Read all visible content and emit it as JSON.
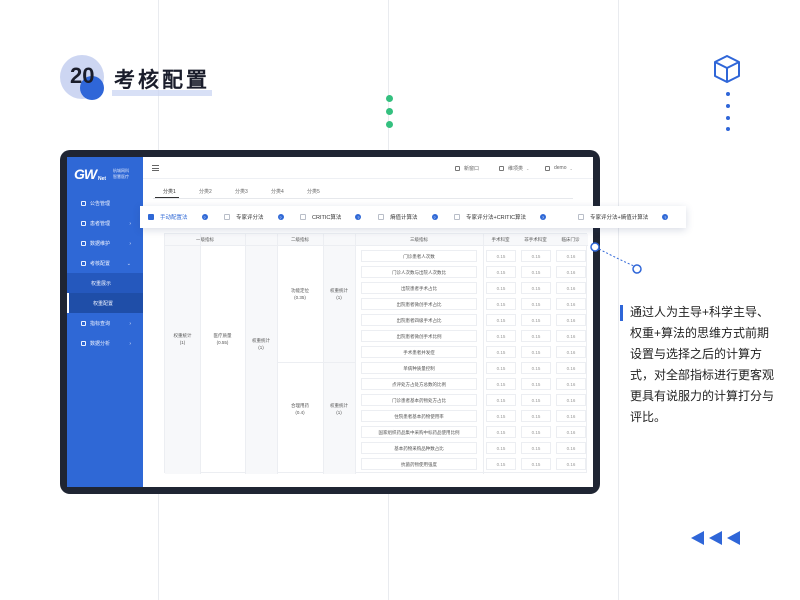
{
  "slide": {
    "number": "20",
    "title": "考核配置",
    "description": "通过人为主导+科学主导、权重+算法的思维方式前期设置与选择之后的计算方式，对全部指标进行更客观更具有说服力的计算打分与评比。",
    "accent_color": "#2f66d8",
    "dot_color": "#34c07f"
  },
  "app": {
    "logo": {
      "mark": "GW",
      "sub": "Net",
      "line1": "杭城网科",
      "line2": "智慧医疗"
    },
    "sidebar": {
      "items": [
        {
          "label": "公告管理",
          "icon": "bell-icon",
          "caret": ""
        },
        {
          "label": "患者管理",
          "icon": "user-icon",
          "caret": "›"
        },
        {
          "label": "数据维护",
          "icon": "database-icon",
          "caret": "›"
        },
        {
          "label": "考核配置",
          "icon": "settings-icon",
          "caret": "⌄"
        },
        {
          "label": "权重展示",
          "icon": "",
          "caret": "",
          "sub": true
        },
        {
          "label": "权重配置",
          "icon": "",
          "caret": "",
          "sub": true,
          "active": true
        },
        {
          "label": "指标查询",
          "icon": "search-icon",
          "caret": "›"
        },
        {
          "label": "数据分析",
          "icon": "chart-icon",
          "caret": "›"
        }
      ]
    },
    "topbar": {
      "fullscreen": "新窗口",
      "user_switch": "维项类",
      "user": "demo"
    },
    "tabs": [
      "分类1",
      "分类2",
      "分类3",
      "分类4",
      "分类5"
    ],
    "selector": {
      "options": [
        {
          "label": "手动配置法",
          "checked": true
        },
        {
          "label": "专家评分法",
          "checked": false
        },
        {
          "label": "CRITIC算法",
          "checked": false
        },
        {
          "label": "熵值计算法",
          "checked": false
        },
        {
          "label": "专家评分法+CRITIC算法",
          "checked": false
        },
        {
          "label": "专家评分法+熵值计算法",
          "checked": false
        }
      ],
      "help_glyph": "?"
    },
    "table": {
      "headers": [
        "一级指标",
        "二级指标",
        "三级指标",
        "手术科室",
        "非手术科室",
        "临床门诊"
      ],
      "col1": {
        "label": "权重统计",
        "value": "(1)"
      },
      "col2": {
        "label": "医疗质量",
        "value": "(0.55)"
      },
      "col3": {
        "label": "权重统计",
        "value": "(1)"
      },
      "groups": [
        {
          "label": "功能定位",
          "value": "(0.35)",
          "sub_label": "权重统计",
          "sub_value": "(1)"
        },
        {
          "label": "合理用药",
          "value": "(0.4)",
          "sub_label": "权重统计",
          "sub_value": "(1)"
        }
      ],
      "rows": [
        {
          "name": "门诊患者人次数",
          "v": [
            "0.15",
            "0.15",
            "0.16"
          ]
        },
        {
          "name": "门诊人次数与出院人次数比",
          "v": [
            "0.15",
            "0.15",
            "0.16"
          ]
        },
        {
          "name": "出院患者手术占比",
          "v": [
            "0.15",
            "0.15",
            "0.16"
          ]
        },
        {
          "name": "出院患者微创手术占比",
          "v": [
            "0.15",
            "0.15",
            "0.16"
          ]
        },
        {
          "name": "出院患者四级手术占比",
          "v": [
            "0.15",
            "0.15",
            "0.16"
          ]
        },
        {
          "name": "出院患者微创手术比例",
          "v": [
            "0.15",
            "0.15",
            "0.16"
          ]
        },
        {
          "name": "手术患者并发症",
          "v": [
            "0.15",
            "0.15",
            "0.16"
          ]
        },
        {
          "name": "单病种质量控制",
          "v": [
            "0.15",
            "0.15",
            "0.16"
          ]
        },
        {
          "name": "点评处方占处方总数的比例",
          "v": [
            "0.15",
            "0.15",
            "0.16"
          ]
        },
        {
          "name": "门诊患者基本药物处方占比",
          "v": [
            "0.15",
            "0.15",
            "0.16"
          ]
        },
        {
          "name": "住院患者基本药物使用率",
          "v": [
            "0.15",
            "0.15",
            "0.16"
          ]
        },
        {
          "name": "国家组织药品集中采购中标药品使用比例",
          "v": [
            "0.15",
            "0.15",
            "0.16"
          ]
        },
        {
          "name": "基本药物采购品种数占比",
          "v": [
            "0.15",
            "0.15",
            "0.16"
          ]
        },
        {
          "name": "抗菌药物使用强度",
          "v": [
            "0.15",
            "0.15",
            "0.16"
          ]
        }
      ]
    }
  }
}
